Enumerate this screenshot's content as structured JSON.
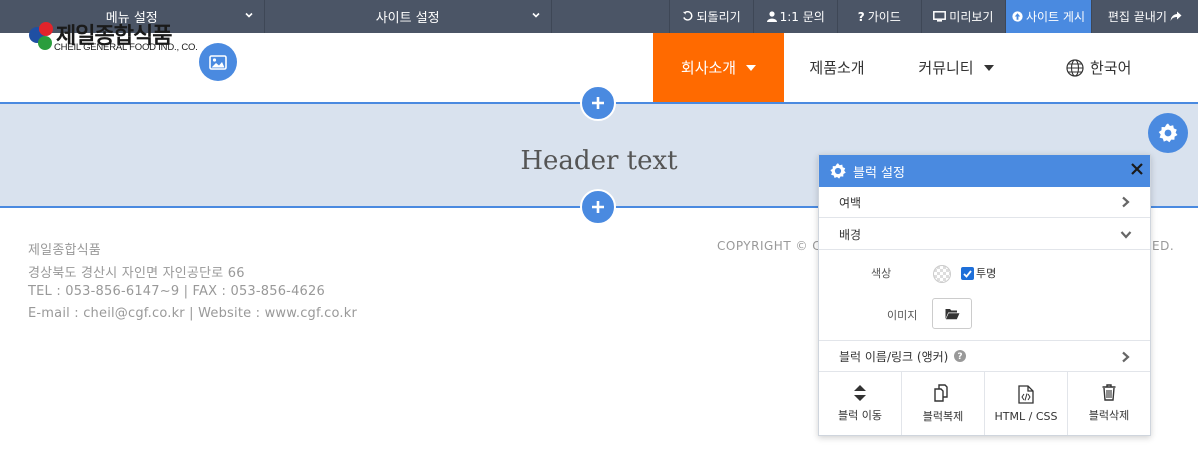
{
  "toolbar": {
    "menu_settings": "메뉴 설정",
    "site_settings": "사이트 설정",
    "undo": "되돌리기",
    "inquiry": "1:1 문의",
    "guide": "가이드",
    "preview": "미리보기",
    "publish": "사이트 게시",
    "finish_edit": "편집 끝내기"
  },
  "logo": {
    "name_ko": "제일종합식품",
    "name_en": "CHEIL GENERAL FOOD IND., CO."
  },
  "nav": {
    "items": [
      {
        "label": "회사소개",
        "active": true,
        "has_dropdown": true
      },
      {
        "label": "제품소개",
        "active": false,
        "has_dropdown": false
      },
      {
        "label": "커뮤니티",
        "active": false,
        "has_dropdown": true
      }
    ],
    "language": "한국어"
  },
  "header_block": {
    "text": "Header text"
  },
  "footer": {
    "company": "제일종합식품",
    "address": "경상북도 경산시 자인면 자인공단로 66",
    "tel_fax": "TEL : 053-856-6147~9  |  FAX : 053-856-4626",
    "email_web": "E-mail : cheil@cgf.co.kr  |  Website : www.cgf.co.kr",
    "copyright_visible": "COPYRIGHT © C",
    "copyright_tail": "ED."
  },
  "panel": {
    "title": "블럭 설정",
    "padding": "여백",
    "background": "배경",
    "color_label": "색상",
    "transparent_label": "투명",
    "transparent_checked": true,
    "image_label": "이미지",
    "anchor_label": "블럭 이름/링크 (앵커)",
    "actions": {
      "move": "블럭 이동",
      "copy": "블럭복제",
      "html_css": "HTML / CSS",
      "delete": "블럭삭제"
    }
  },
  "colors": {
    "toolbar_bg": "#4b5566",
    "accent": "#4a8ae0",
    "nav_active": "#ff6a00",
    "header_block_bg": "#d9e2ee"
  }
}
